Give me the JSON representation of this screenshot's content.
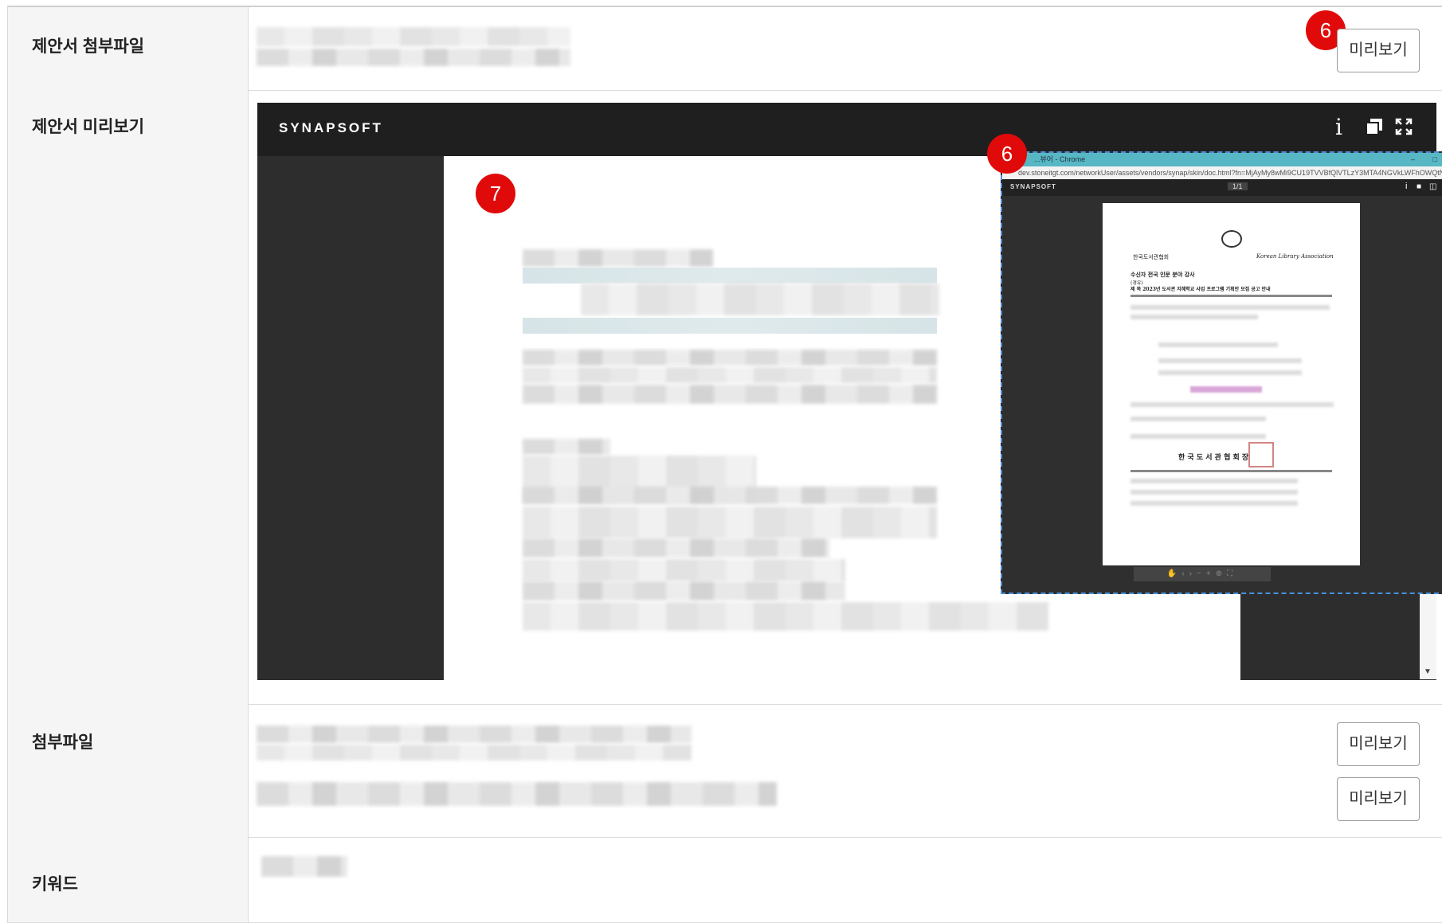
{
  "rows": {
    "proposal_attachment": {
      "label": "제안서 첨부파일",
      "button": "미리보기",
      "badge": "6"
    },
    "proposal_preview": {
      "label": "제안서 미리보기",
      "badge": "7"
    },
    "attachments": {
      "label": "첨부파일",
      "buttons": [
        "미리보기",
        "미리보기"
      ]
    },
    "keyword": {
      "label": "키워드"
    }
  },
  "viewer": {
    "logo": "SYNAPSOFT",
    "icons": [
      "info-icon",
      "copy-window-icon",
      "fullscreen-icon"
    ]
  },
  "popup": {
    "badge": "6",
    "window_title": "...뷰어 - Chrome",
    "url": "dev.stoneitgt.com/networkUser/assets/vendors/synap/skin/doc.html?fn=MjAyMy8wMi9CU19TVVBfQlVTLzY3MTA4NGVkLWFhOWQtNDExZ",
    "logo": "SYNAPSOFT",
    "page_indicator": "1/1",
    "doc": {
      "org_kr": "한국도서관협회",
      "org_en": "Korean Library Association",
      "recipient": "수신자   전국 인문 분야 강사",
      "via": "(경유)",
      "subject": "제  목   2023년 도서관 지혜학교 사업 프로그램 기획안 모집 공고 안내",
      "signature": "한 국 도 서 관 협 회 장"
    }
  },
  "colors": {
    "badge": "#e10a0a",
    "viewer_bg": "#2d2d2d",
    "popup_titlebar": "#58b7c4"
  }
}
